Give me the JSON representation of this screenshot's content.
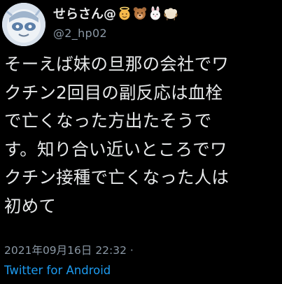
{
  "author": {
    "display_name": "せらさん@",
    "handle": "@2_hp02",
    "name_emojis": [
      "angel-emoji",
      "bear-face-emoji",
      "rabbit-face-emoji",
      "ram-emoji"
    ]
  },
  "tweet": {
    "lines": [
      "そーえば妹の旦那の会社でワ",
      "クチン2回目の副反応は血栓",
      "で亡くなった方出たそうで",
      "す。知り合い近いところでワ",
      "クチン接種で亡くなった人は",
      "初めて"
    ]
  },
  "meta": {
    "timestamp": "2021年09月16日 22:32 ·",
    "source": "Twitter for Android"
  },
  "colors": {
    "background": "#000000",
    "text": "#e7e9ea",
    "secondary_text": "#8b98a5",
    "link": "#1d9bf0"
  }
}
